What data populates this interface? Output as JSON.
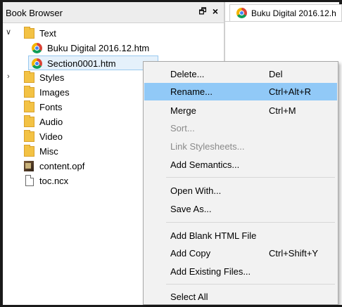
{
  "panel": {
    "title": "Book Browser",
    "float_icon": "float-icon",
    "float_glyph": "🗗",
    "close_glyph": "×"
  },
  "tree": {
    "items": [
      {
        "label": "Text",
        "icon": "folder-icon",
        "expanded": true
      },
      {
        "label": "Buku Digital 2016.12.htm",
        "icon": "chrome-icon"
      },
      {
        "label": "Section0001.htm",
        "icon": "chrome-icon",
        "selected": true
      },
      {
        "label": "Styles",
        "icon": "folder-icon",
        "expandable": true
      },
      {
        "label": "Images",
        "icon": "folder-icon"
      },
      {
        "label": "Fonts",
        "icon": "folder-icon"
      },
      {
        "label": "Audio",
        "icon": "folder-icon"
      },
      {
        "label": "Video",
        "icon": "folder-icon"
      },
      {
        "label": "Misc",
        "icon": "folder-icon"
      },
      {
        "label": "content.opf",
        "icon": "opf-file-icon"
      },
      {
        "label": "toc.ncx",
        "icon": "file-icon"
      }
    ],
    "chevron_down": "∨",
    "chevron_right": "›"
  },
  "editor": {
    "tab_label": "Buku Digital 2016.12.h"
  },
  "context_menu": {
    "items": [
      {
        "label": "Delete...",
        "shortcut": "Del"
      },
      {
        "label": "Rename...",
        "shortcut": "Ctrl+Alt+R",
        "highlighted": true
      },
      {
        "label": "Merge",
        "shortcut": "Ctrl+M"
      },
      {
        "label": "Sort...",
        "disabled": true
      },
      {
        "label": "Link Stylesheets...",
        "disabled": true
      },
      {
        "label": "Add Semantics..."
      },
      {
        "label": "Open With..."
      },
      {
        "label": "Save As..."
      },
      {
        "label": "Add Blank HTML File"
      },
      {
        "label": "Add Copy",
        "shortcut": "Ctrl+Shift+Y"
      },
      {
        "label": "Add Existing Files..."
      },
      {
        "label": "Select All"
      }
    ]
  },
  "colors": {
    "menu_highlight": "#91c9f7",
    "selection_fill": "#e5f1fb",
    "selection_border": "#99c9ef",
    "folder": "#f3c244"
  }
}
